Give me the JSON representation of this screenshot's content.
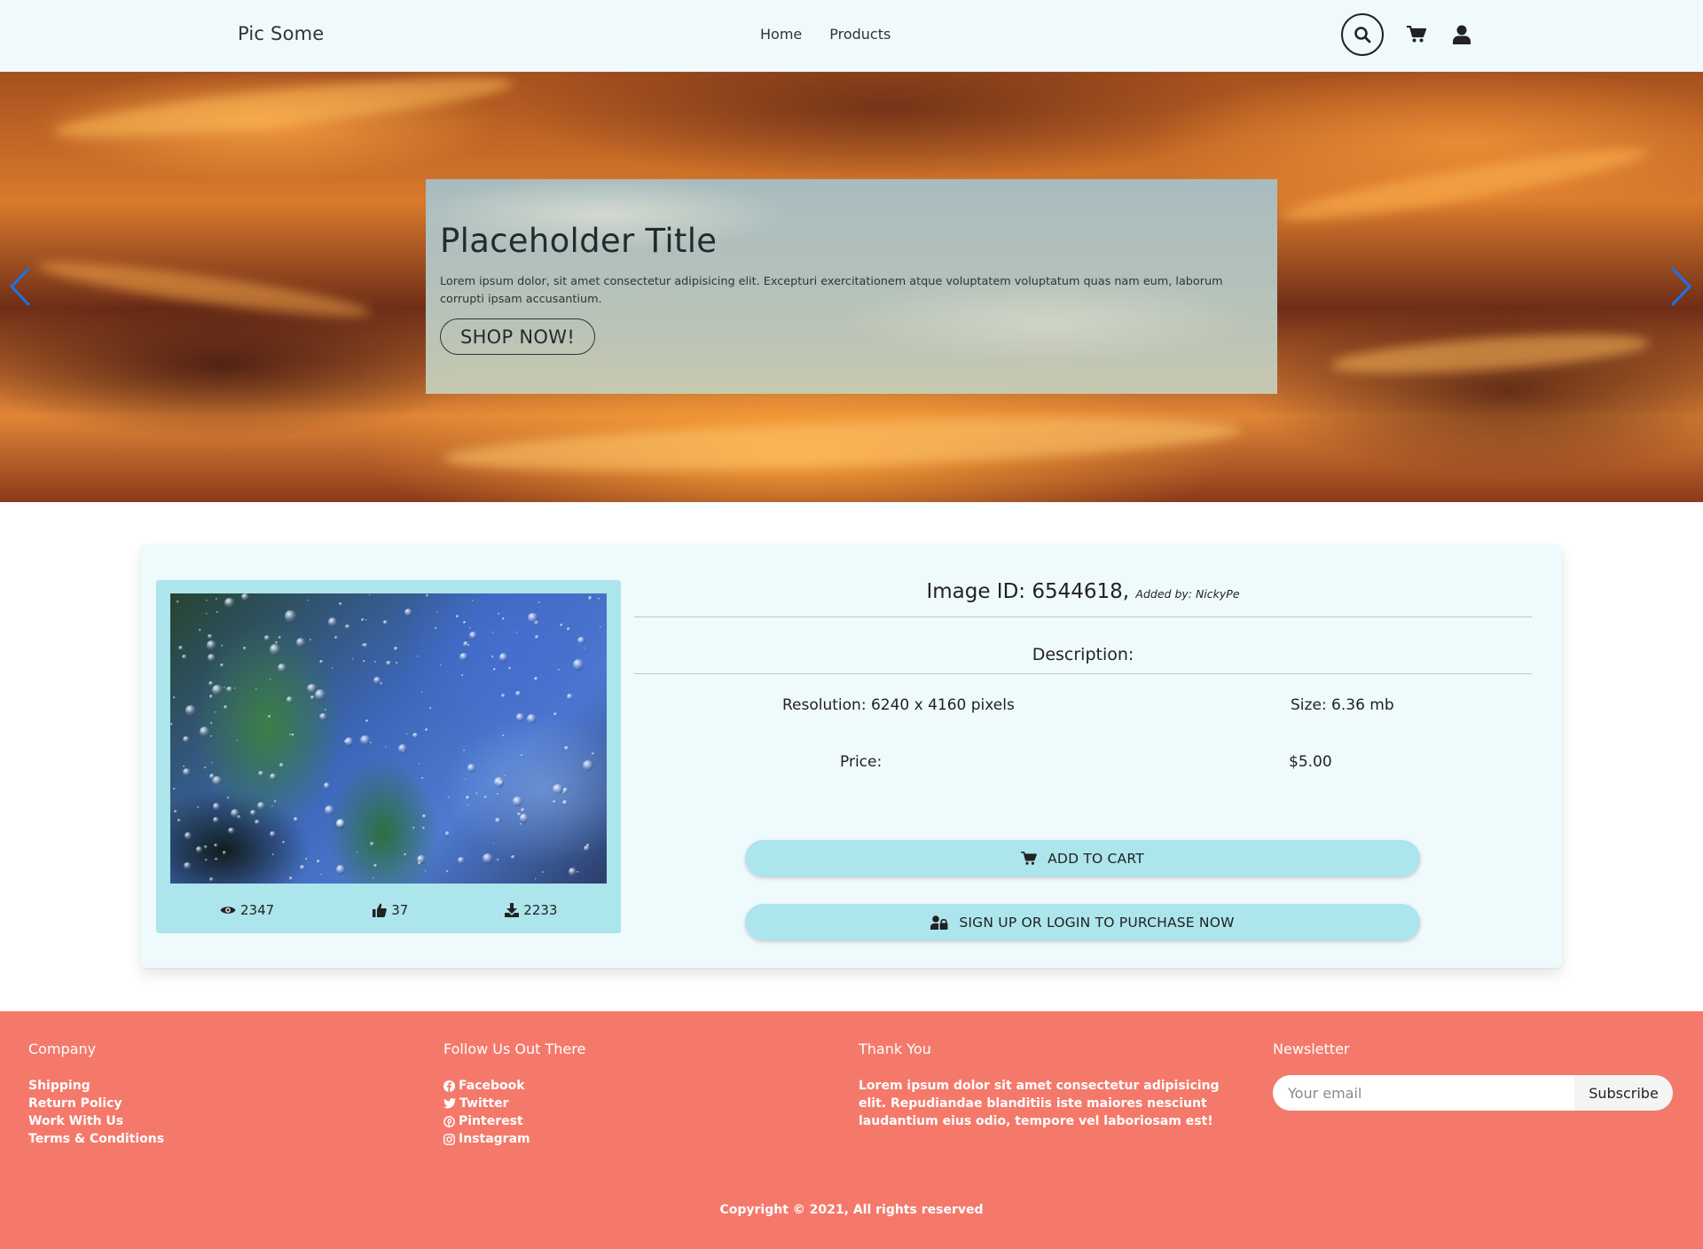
{
  "navbar": {
    "brand": "Pic Some",
    "links": [
      {
        "label": "Home"
      },
      {
        "label": "Products"
      }
    ],
    "icons": [
      "search-icon",
      "cart-icon",
      "user-icon"
    ]
  },
  "hero": {
    "title": "Placeholder Title",
    "text": "Lorem ipsum dolor, sit amet consectetur adipisicing elit. Excepturi exercitationem atque voluptatem voluptatum quas nam eum, laborum corrupti ipsam accusantium.",
    "button": "SHOP NOW!",
    "arrow_color": "#1a73e8"
  },
  "product": {
    "image_id_text": "Image ID: 6544618,",
    "added_by": "Added by: NickyPe",
    "description_label": "Description:",
    "resolution": "Resolution: 6240 x 4160 pixels",
    "size": "Size: 6.36 mb",
    "price_label": "Price:",
    "price": "$5.00",
    "stats": {
      "views": "2347",
      "likes": "37",
      "downloads": "2233"
    },
    "add_to_cart": "ADD TO CART",
    "signup": "SIGN UP OR LOGIN TO PURCHASE NOW"
  },
  "footer": {
    "company": {
      "title": "Company",
      "links": [
        "Shipping",
        "Return Policy",
        "Work With Us",
        "Terms & Conditions"
      ]
    },
    "follow": {
      "title": "Follow Us Out There",
      "links": [
        "Facebook",
        "Twitter",
        "Pinterest",
        "Instagram"
      ]
    },
    "thanks": {
      "title": "Thank You",
      "text": "Lorem ipsum dolor sit amet consectetur adipisicing elit. Repudiandae blanditiis iste maiores nesciunt laudantium eius odio, tempore vel laboriosam est!"
    },
    "newsletter": {
      "title": "Newsletter",
      "placeholder": "Your email",
      "button": "Subscribe"
    },
    "copyright": "Copyright © 2021, All rights reserved"
  },
  "colors": {
    "navbar_bg": "#f0fafd",
    "card_bg": "#effafd",
    "accent": "#ade5ec",
    "footer_bg": "#f4796b"
  }
}
